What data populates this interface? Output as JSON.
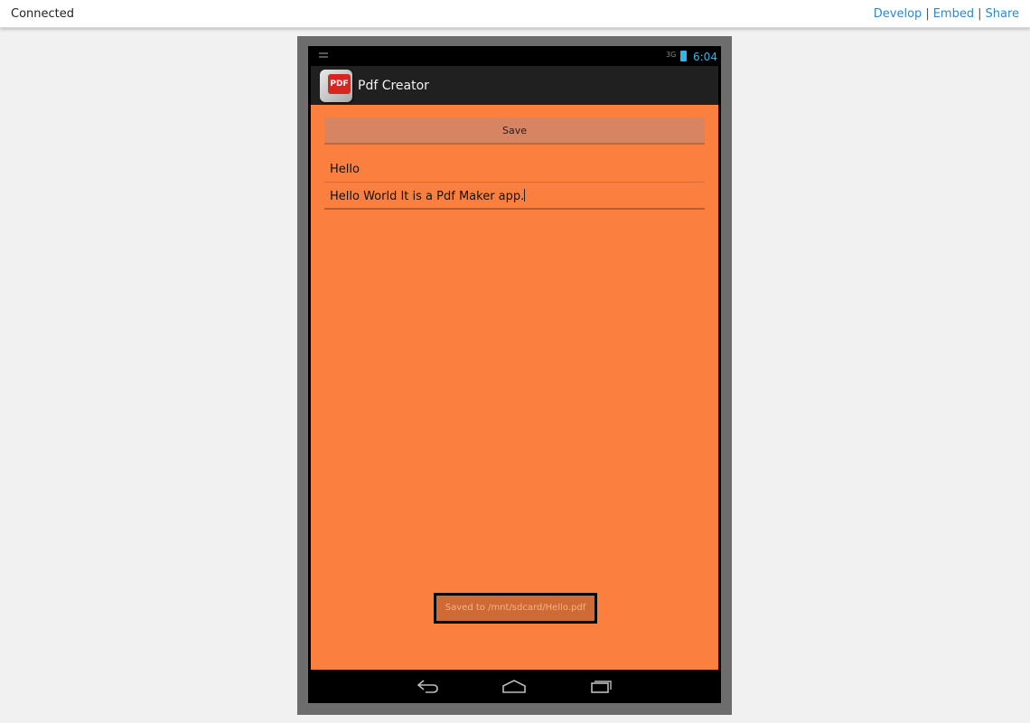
{
  "topbar": {
    "status": "Connected",
    "links": [
      "Develop",
      "Embed",
      "Share"
    ]
  },
  "device": {
    "status_bar": {
      "network": "3G",
      "time": "6:04"
    },
    "action_bar": {
      "app_icon_text": "PDF",
      "title": "Pdf Creator"
    },
    "form": {
      "save_label": "Save",
      "title_value": "Hello",
      "body_value": "Hello World It is a Pdf Maker app."
    },
    "toast": "Saved to /mnt/sdcard/Hello.pdf"
  },
  "colors": {
    "screen_bg": "#fb803f",
    "accent": "#33b5e5",
    "link": "#2a8bd0"
  }
}
